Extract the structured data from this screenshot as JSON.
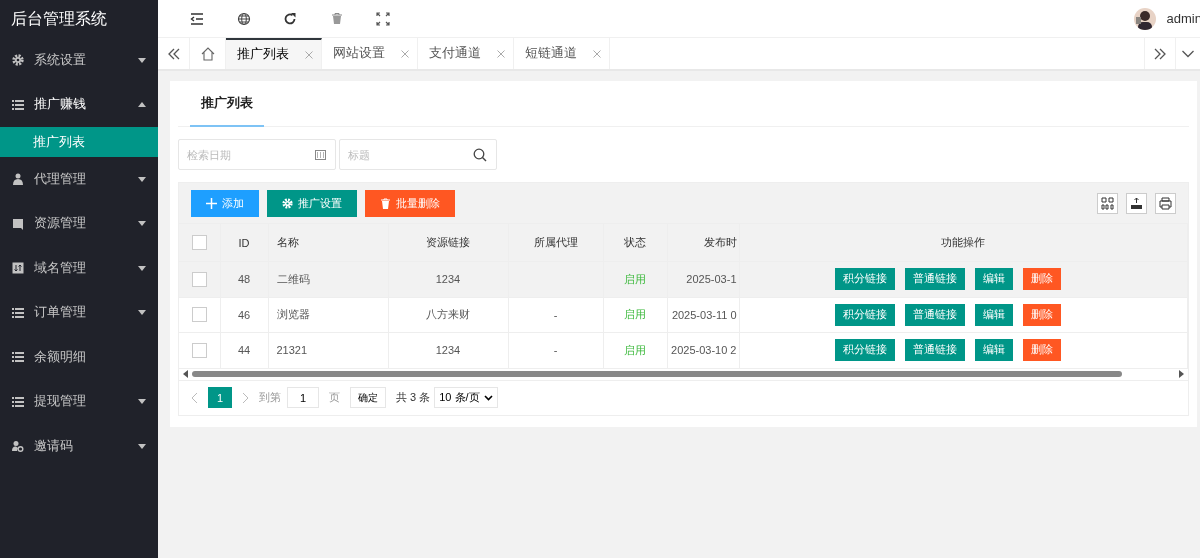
{
  "sidebar": {
    "title": "后台管理系统",
    "items": [
      {
        "label": "系统设置",
        "expandable": true,
        "expanded": false
      },
      {
        "label": "推广赚钱",
        "expandable": true,
        "expanded": true,
        "children": [
          {
            "label": "推广列表",
            "selected": true
          }
        ]
      },
      {
        "label": "代理管理",
        "expandable": true,
        "expanded": false
      },
      {
        "label": "资源管理",
        "expandable": true,
        "expanded": false
      },
      {
        "label": "域名管理",
        "expandable": true,
        "expanded": false
      },
      {
        "label": "订单管理",
        "expandable": true,
        "expanded": false
      },
      {
        "label": "余额明细",
        "expandable": false,
        "expanded": false
      },
      {
        "label": "提现管理",
        "expandable": true,
        "expanded": false
      },
      {
        "label": "邀请码",
        "expandable": true,
        "expanded": false
      }
    ]
  },
  "header": {
    "user": "admin"
  },
  "tabs": [
    {
      "label": "推广列表",
      "selected": true
    },
    {
      "label": "网站设置",
      "selected": false
    },
    {
      "label": "支付通道",
      "selected": false
    },
    {
      "label": "短链通道",
      "selected": false
    }
  ],
  "card": {
    "title": "推广列表",
    "search": [
      {
        "placeholder": "检索日期",
        "kind": "date"
      },
      {
        "placeholder": "标题",
        "kind": "search"
      }
    ],
    "buttons": [
      {
        "label": "添加",
        "kind": "primary"
      },
      {
        "label": "推广设置",
        "kind": "teal"
      },
      {
        "label": "批量删除",
        "kind": "danger"
      }
    ],
    "table": {
      "all_checked": false,
      "columns": [
        "ID",
        "名称",
        "资源链接",
        "所属代理",
        "状态",
        "发布时",
        "功能操作"
      ],
      "rows": [
        {
          "checked": false,
          "hovered": true,
          "cells": [
            "48",
            "二维码",
            "1234",
            "",
            "启用",
            "2025-03-1"
          ],
          "actions": [
            {
              "label": "积分链接",
              "kind": "teal"
            },
            {
              "label": "普通链接",
              "kind": "teal"
            },
            {
              "label": "编辑",
              "kind": "teal"
            },
            {
              "label": "删除",
              "kind": "danger"
            }
          ]
        },
        {
          "checked": false,
          "hovered": false,
          "cells": [
            "46",
            "浏览器",
            "八方来财",
            "-",
            "启用",
            "2025-03-11 0"
          ],
          "actions": [
            {
              "label": "积分链接",
              "kind": "teal"
            },
            {
              "label": "普通链接",
              "kind": "teal"
            },
            {
              "label": "编辑",
              "kind": "teal"
            },
            {
              "label": "删除",
              "kind": "danger"
            }
          ]
        },
        {
          "checked": false,
          "hovered": false,
          "cells": [
            "44",
            "21321",
            "1234",
            "-",
            "启用",
            "2025-03-10 2"
          ],
          "actions": [
            {
              "label": "积分链接",
              "kind": "teal"
            },
            {
              "label": "普通链接",
              "kind": "teal"
            },
            {
              "label": "编辑",
              "kind": "teal"
            },
            {
              "label": "删除",
              "kind": "danger"
            }
          ]
        }
      ]
    },
    "pager": {
      "pages": [
        {
          "label": "1",
          "selected": true
        }
      ],
      "goto_label": "到第",
      "goto_value": "1",
      "page_unit": "页",
      "confirm": "确定",
      "total": "共 3 条",
      "page_size": "10 条/页"
    }
  }
}
